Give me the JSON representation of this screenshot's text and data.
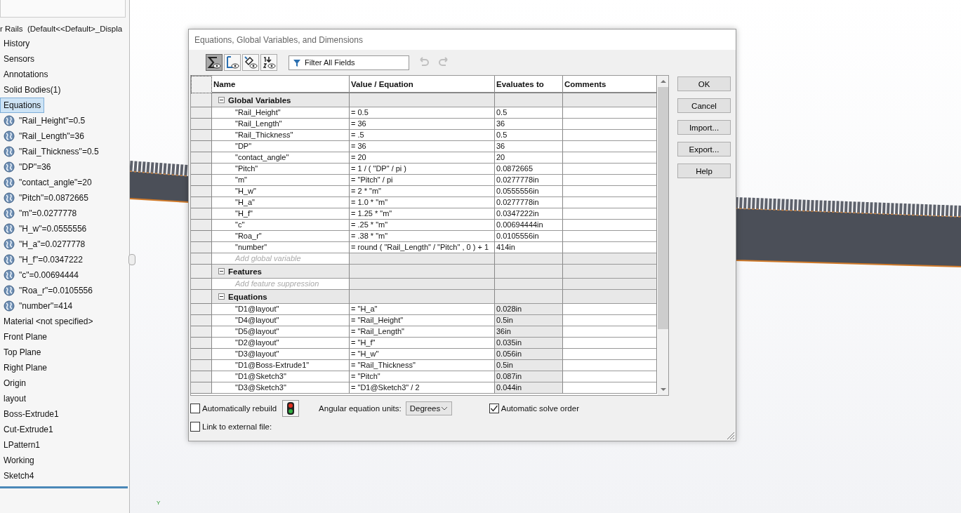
{
  "feature_tree": {
    "root": {
      "label": "r Rails  (Default<<Default>_Displa"
    },
    "items": [
      {
        "label": "History",
        "selected": false
      },
      {
        "label": "Sensors",
        "selected": false
      },
      {
        "label": "Annotations",
        "selected": false
      },
      {
        "label": "Solid Bodies(1)",
        "selected": false
      },
      {
        "label": "Equations",
        "selected": true,
        "children": [
          {
            "label": "\"Rail_Height\"=0.5",
            "selected": false
          },
          {
            "label": "\"Rail_Length\"=36",
            "selected": false
          },
          {
            "label": "\"Rail_Thickness\"=0.5",
            "selected": false
          },
          {
            "label": "\"DP\"=36",
            "selected": false
          },
          {
            "label": "\"contact_angle\"=20",
            "selected": false
          },
          {
            "label": "\"Pitch\"=0.0872665",
            "selected": false
          },
          {
            "label": "\"m\"=0.0277778",
            "selected": false
          },
          {
            "label": "\"H_w\"=0.0555556",
            "selected": false
          },
          {
            "label": "\"H_a\"=0.0277778",
            "selected": false
          },
          {
            "label": "\"H_f\"=0.0347222",
            "selected": false
          },
          {
            "label": "\"c\"=0.00694444",
            "selected": false
          },
          {
            "label": "\"Roa_r\"=0.0105556",
            "selected": false
          },
          {
            "label": "\"number\"=414",
            "selected": false
          }
        ]
      },
      {
        "label": "Material <not specified>",
        "selected": false
      },
      {
        "label": "Front Plane",
        "selected": false
      },
      {
        "label": "Top Plane",
        "selected": false
      },
      {
        "label": "Right Plane",
        "selected": false
      },
      {
        "label": "Origin",
        "selected": false
      },
      {
        "label": "layout",
        "selected": false
      },
      {
        "label": "Boss-Extrude1",
        "selected": false
      },
      {
        "label": "Cut-Extrude1",
        "selected": false
      },
      {
        "label": "LPattern1",
        "selected": false
      },
      {
        "label": "Working",
        "selected": false
      },
      {
        "label": "Sketch4",
        "selected": false
      }
    ]
  },
  "viewport": {
    "axis_label": "Y"
  },
  "dialog": {
    "title": "Equations, Global Variables, and Dimensions",
    "toolbar": {
      "view_buttons": [
        {
          "kind": "equations",
          "selected": true
        },
        {
          "kind": "sketch",
          "selected": false
        },
        {
          "kind": "dimensions",
          "selected": false
        },
        {
          "kind": "ordered",
          "selected": false
        }
      ],
      "filter": {
        "placeholder": "Filter All Fields"
      },
      "undo": {
        "disabled": true
      },
      "redo": {
        "disabled": true
      }
    },
    "table": {
      "columns": [
        "Name",
        "Value / Equation",
        "Evaluates to",
        "Comments"
      ],
      "sections": [
        {
          "kind": "variables",
          "title": "Global Variables",
          "expanded": true,
          "rows": [
            {
              "name": "\"Rail_Height\"",
              "value": "= 0.5",
              "evaluates": "0.5"
            },
            {
              "name": "\"Rail_Length\"",
              "value": "= 36",
              "evaluates": "36"
            },
            {
              "name": "\"Rail_Thickness\"",
              "value": "= .5",
              "evaluates": "0.5"
            },
            {
              "name": "\"DP\"",
              "value": "= 36",
              "evaluates": "36"
            },
            {
              "name": "\"contact_angle\"",
              "value": "= 20",
              "evaluates": "20"
            },
            {
              "name": "\"Pitch\"",
              "value": "= 1 / ( \"DP\" / pi )",
              "evaluates": "0.0872665"
            },
            {
              "name": "\"m\"",
              "value": "= \"Pitch\" / pi",
              "evaluates": "0.0277778in"
            },
            {
              "name": "\"H_w\"",
              "value": "= 2 * \"m\"",
              "evaluates": "0.0555556in"
            },
            {
              "name": "\"H_a\"",
              "value": "= 1.0 * \"m\"",
              "evaluates": "0.0277778in"
            },
            {
              "name": "\"H_f\"",
              "value": "= 1.25 * \"m\"",
              "evaluates": "0.0347222in"
            },
            {
              "name": "\"c\"",
              "value": "= .25 * \"m\"",
              "evaluates": "0.00694444in"
            },
            {
              "name": "\"Roa_r\"",
              "value": "= .38 * \"m\"",
              "evaluates": "0.0105556in"
            },
            {
              "name": "\"number\"",
              "value": "= round ( \"Rail_Length\" / \"Pitch\" , 0 ) + 1",
              "evaluates": "414in"
            }
          ],
          "add_placeholder": "Add global variable"
        },
        {
          "title": "Features",
          "expanded": true,
          "add_placeholder": "Add feature suppression"
        },
        {
          "kind": "equations",
          "title": "Equations",
          "expanded": true,
          "rows": [
            {
              "name": "\"D1@layout\"",
              "value": "= \"H_a\"",
              "evaluates": "0.028in"
            },
            {
              "name": "\"D4@layout\"",
              "value": "= \"Rail_Height\"",
              "evaluates": "0.5in"
            },
            {
              "name": "\"D5@layout\"",
              "value": "= \"Rail_Length\"",
              "evaluates": "36in"
            },
            {
              "name": "\"D2@layout\"",
              "value": "= \"H_f\"",
              "evaluates": "0.035in"
            },
            {
              "name": "\"D3@layout\"",
              "value": "= \"H_w\"",
              "evaluates": "0.056in"
            },
            {
              "name": "\"D1@Boss-Extrude1\"",
              "value": "= \"Rail_Thickness\"",
              "evaluates": "0.5in"
            },
            {
              "name": "\"D1@Sketch3\"",
              "value": "= \"Pitch\"",
              "evaluates": "0.087in"
            },
            {
              "name": "\"D3@Sketch3\"",
              "value": "= \"D1@Sketch3\" / 2",
              "evaluates": "0.044in"
            }
          ]
        }
      ]
    },
    "options": {
      "auto_rebuild": {
        "label": "Automatically rebuild",
        "checked": false
      },
      "angular_units": {
        "label": "Angular equation units:",
        "value": "Degrees"
      },
      "auto_solve": {
        "label": "Automatic solve order",
        "checked": true
      },
      "link_external": {
        "label": "Link to external file:",
        "checked": false
      }
    },
    "buttons": [
      "OK",
      "Cancel",
      "Import...",
      "Export...",
      "Help"
    ]
  }
}
